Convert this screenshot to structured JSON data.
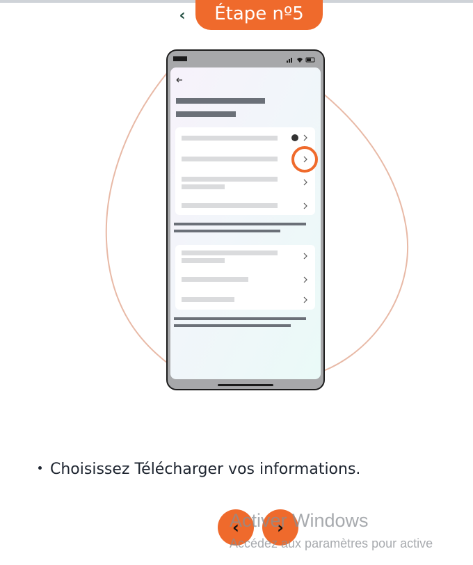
{
  "header": {
    "back_icon": "chevron-left-icon",
    "step_label": "Étape nº5",
    "accent_color": "#ef6a2c",
    "back_color": "#1f4d3f"
  },
  "illustration": {
    "phone_status_icons": [
      "signal-icon",
      "wifi-icon",
      "battery-icon"
    ],
    "menu_icons": [
      "facebook-icon",
      "chevron-right-icon"
    ],
    "highlight_color": "#ef6a2c",
    "blob_color": "#e8b9a6"
  },
  "instruction": {
    "prefix": "Choisissez ",
    "highlight": "Télécharger vos informations",
    "suffix": "."
  },
  "pager": {
    "prev_icon": "chevron-left-icon",
    "next_icon": "chevron-right-icon"
  },
  "watermark": {
    "title": "Activer Windows",
    "subtitle": "Accédez aux paramètres pour active"
  }
}
